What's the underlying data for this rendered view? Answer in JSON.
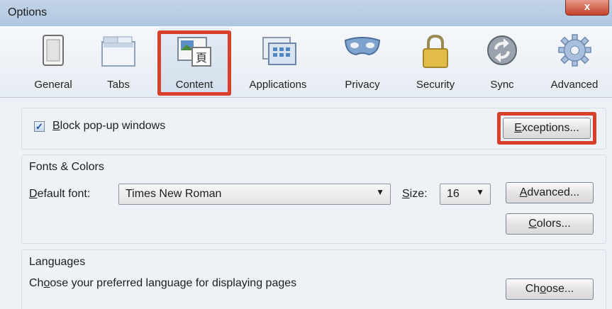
{
  "window": {
    "title": "Options",
    "close_glyph": "x"
  },
  "toolbar": {
    "items": [
      {
        "label": "General",
        "icon": "general-window-icon"
      },
      {
        "label": "Tabs",
        "icon": "tabs-icon"
      },
      {
        "label": "Content",
        "icon": "content-icon",
        "selected": true
      },
      {
        "label": "Applications",
        "icon": "applications-icon"
      },
      {
        "label": "Privacy",
        "icon": "privacy-mask-icon"
      },
      {
        "label": "Security",
        "icon": "padlock-icon"
      },
      {
        "label": "Sync",
        "icon": "sync-icon"
      },
      {
        "label": "Advanced",
        "icon": "gear-icon"
      }
    ]
  },
  "popup": {
    "checkbox_checked": true,
    "check_glyph": "✓",
    "label_mnemonic": "B",
    "label_rest": "lock pop-up windows",
    "exceptions_mnemonic": "E",
    "exceptions_rest": "xceptions..."
  },
  "fonts": {
    "heading": "Fonts & Colors",
    "default_font_mnemonic": "D",
    "default_font_rest": "efault font:",
    "default_font_value": "Times New Roman",
    "size_mnemonic": "S",
    "size_rest": "ize:",
    "size_value": "16",
    "advanced_pre": "",
    "advanced_mnemonic": "A",
    "advanced_rest": "dvanced...",
    "colors_mnemonic": "C",
    "colors_rest": "olors...",
    "dropdown_glyph": "▼"
  },
  "languages": {
    "heading": "Languages",
    "desc_pre": "Ch",
    "desc_mnemonic": "o",
    "desc_rest": "ose your preferred language for displaying pages",
    "choose_pre": "Ch",
    "choose_mnemonic": "o",
    "choose_rest": "ose..."
  },
  "colors": {
    "highlight": "#d9402c",
    "panel": "#eef2f7"
  }
}
